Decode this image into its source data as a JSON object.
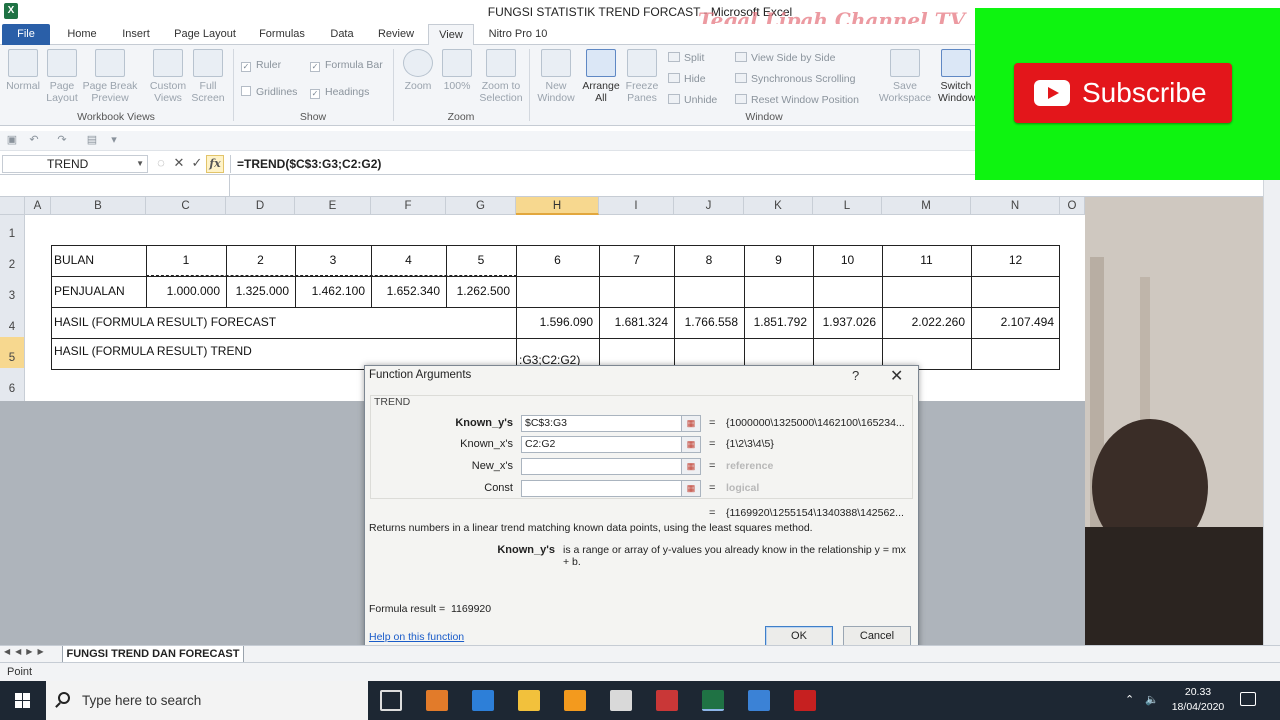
{
  "window": {
    "title": "FUNGSI STATISTIK TREND FORCAST  -  Microsoft Excel",
    "watermark": "Tegal Lipah Channel TV"
  },
  "tabs": [
    "File",
    "Home",
    "Insert",
    "Page Layout",
    "Formulas",
    "Data",
    "Review",
    "View",
    "Nitro Pro 10"
  ],
  "active_tab": "View",
  "ribbon": {
    "workbook_views": {
      "label": "Workbook Views",
      "buttons": [
        "Normal",
        "Page Layout",
        "Page Break Preview",
        "Custom Views",
        "Full Screen"
      ]
    },
    "show": {
      "label": "Show",
      "checks": [
        {
          "label": "Ruler",
          "checked": true
        },
        {
          "label": "Formula Bar",
          "checked": true
        },
        {
          "label": "Gridlines",
          "checked": false
        },
        {
          "label": "Headings",
          "checked": true
        }
      ]
    },
    "zoom": {
      "label": "Zoom",
      "buttons": [
        "Zoom",
        "100%",
        "Zoom to Selection"
      ]
    },
    "window": {
      "label": "Window",
      "buttons": [
        "New Window",
        "Arrange All",
        "Freeze Panes"
      ],
      "small": [
        "Split",
        "Hide",
        "Unhide",
        "View Side by Side",
        "Synchronous Scrolling",
        "Reset Window Position"
      ],
      "right_buttons": [
        "Save Workspace",
        "Switch Windows"
      ]
    }
  },
  "formula_bar": {
    "name_box": "TREND",
    "formula": "=TREND($C$3:G3;C2:G2)",
    "fx": "fx"
  },
  "overlay": {
    "subscribe": "Subscribe"
  },
  "sheet": {
    "columns": [
      "A",
      "B",
      "C",
      "D",
      "E",
      "F",
      "G",
      "H",
      "I",
      "J",
      "K",
      "L",
      "M",
      "N",
      "O"
    ],
    "selected_column": "H",
    "rows": [
      "1",
      "2",
      "3",
      "4",
      "5",
      "6"
    ],
    "selected_row": "5",
    "row2": {
      "label": "BULAN",
      "values": [
        "1",
        "2",
        "3",
        "4",
        "5",
        "6",
        "7",
        "8",
        "9",
        "10",
        "11",
        "12"
      ]
    },
    "row3": {
      "label": "PENJUALAN",
      "values": [
        "1.000.000",
        "1.325.000",
        "1.462.100",
        "1.652.340",
        "1.262.500"
      ]
    },
    "row4": {
      "label": "HASIL (FORMULA RESULT) FORECAST",
      "values": [
        "1.596.090",
        "1.681.324",
        "1.766.558",
        "1.851.792",
        "1.937.026",
        "2.022.260",
        "2.107.494"
      ]
    },
    "row5": {
      "label": "HASIL (FORMULA RESULT) TREND",
      "editing": ":G3;C2:G2)"
    }
  },
  "dialog": {
    "title": "Function Arguments",
    "help_glyph": "?",
    "close_glyph": "✕",
    "function": "TREND",
    "args": [
      {
        "label": "Known_y's",
        "value": "$C$3:G3",
        "result": "{1000000\\1325000\\1462100\\165234...",
        "bold": true,
        "dim": false
      },
      {
        "label": "Known_x's",
        "value": "C2:G2",
        "result": "{1\\2\\3\\4\\5}",
        "bold": false,
        "dim": false
      },
      {
        "label": "New_x's",
        "value": "",
        "result": "reference",
        "bold": false,
        "dim": true
      },
      {
        "label": "Const",
        "value": "",
        "result": "logical",
        "bold": false,
        "dim": true
      }
    ],
    "overall_result": "{1169920\\1255154\\1340388\\142562...",
    "description": "Returns numbers in a linear trend matching known data points, using the least squares method.",
    "arg_help_name": "Known_y's",
    "arg_help_text": "is a range or array of y-values you already know in the relationship y = mx + b.",
    "formula_result_label": "Formula result =",
    "formula_result_value": "1169920",
    "help_link": "Help on this function",
    "ok": "OK",
    "cancel": "Cancel"
  },
  "sheet_tab": "FUNGSI TREND DAN FORECAST",
  "status": "Point",
  "taskbar": {
    "search_placeholder": "Type here to search",
    "time": "20.33",
    "date": "18/04/2020"
  }
}
